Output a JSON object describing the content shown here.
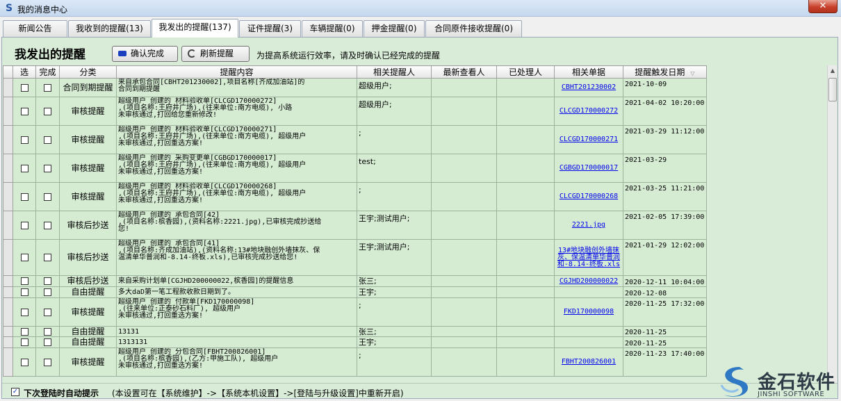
{
  "window": {
    "title": "我的消息中心",
    "close_label": "✕"
  },
  "tabs": [
    {
      "label": "新闻公告"
    },
    {
      "label": "我收到的提醒(13)"
    },
    {
      "label": "我发出的提醒(137)"
    },
    {
      "label": "证件提醒(3)"
    },
    {
      "label": "车辆提醒(0)"
    },
    {
      "label": "押金提醒(0)"
    },
    {
      "label": "合同原件接收提醒(0)"
    }
  ],
  "toolbar": {
    "heading": "我发出的提醒",
    "confirm_label": "确认完成",
    "refresh_label": "刷新提醒",
    "hint": "为提高系统运行效率，请及时确认已经完成的提醒"
  },
  "table": {
    "columns": [
      "选",
      "完成",
      "分类",
      "提醒内容",
      "相关提醒人",
      "最新查看人",
      "已处理人",
      "相关单据",
      "提醒触发日期"
    ],
    "sort_glyph": "▽",
    "rows": [
      {
        "type": "合同到期提醒",
        "content": [
          "来自承包合同[CBHT201230002],项目名称[齐成加油站]的",
          "合同到期提醒"
        ],
        "people": "超级用户;",
        "doc": "CBHT201230002",
        "date": "2021-10-09"
      },
      {
        "type": "审核提醒",
        "content": [
          "超级用户 创建的 材料验收单[CLCGD170000272]",
          ",(项目名称:王府井广场),(往来单位:南方电缆), 小路",
          "未审核通过,打回给您重新修改!"
        ],
        "people": "超级用户;",
        "doc": "CLCGD170000272",
        "date": "2021-04-02 10:20:00"
      },
      {
        "type": "审核提醒",
        "content": [
          "超级用户 创建的 材料验收单[CLCGD170000271]",
          ",(项目名称:王府井广场),(往来单位:南方电缆), 超级用户",
          "未审核通过,打回重选方案!"
        ],
        "people": ";",
        "doc": "CLCGD170000271",
        "date": "2021-03-29 11:12:00"
      },
      {
        "type": "审核提醒",
        "content": [
          "超级用户 创建的 采购变更单[CGBGD170000017]",
          ",(项目名称:王府井广场),(往来单位:南方电缆), 超级用户",
          "未审核通过,打回重选方案!"
        ],
        "people": "test;",
        "doc": "CGBGD170000017",
        "date": "2021-03-29"
      },
      {
        "type": "审核提醒",
        "content": [
          "超级用户 创建的 材料验收单[CLCGD170000268]",
          ",(项目名称:王府井广场),(往来单位:南方电缆), 超级用户",
          "未审核通过,打回重选方案!"
        ],
        "people": ";",
        "doc": "CLCGD170000268",
        "date": "2021-03-25 11:21:00"
      },
      {
        "type": "审核后抄送",
        "content": [
          "超级用户 创建的 承包合同[42]",
          ",(项目名称:槟香园),(资料名称:2221.jpg),已审核完成抄送给",
          "您!"
        ],
        "people": "王宇;测试用户;",
        "doc": "2221.jpg",
        "date": "2021-02-05 17:39:00"
      },
      {
        "type": "审核后抄送",
        "content": [
          "超级用户 创建的 承包合同[41]",
          ",(项目名称:齐成加油站),(资料名称:13#地块融创外墙抹灰、保",
          "温清单华普润和-8.14-终板.xls),已审核完成抄送给您!"
        ],
        "people": "王宇;测试用户;",
        "doc": "13#地块融创外墙抹灰、保温清单华普润和-8.14-终板.xls",
        "date": "2021-01-29 12:02:00"
      },
      {
        "type": "审核后抄送",
        "content": [
          "来自采购计划单[CGJHD200000022,槟香园]的提醒信息"
        ],
        "people": "张三;",
        "doc": "CGJHD200000022",
        "date": "2020-12-11 10:04:00"
      },
      {
        "type": "自由提醒",
        "content": [
          "多大daD第一笔工程款收款日期到了。"
        ],
        "people": "王宇;",
        "doc": "",
        "date": "2020-12-08"
      },
      {
        "type": "审核提醒",
        "content": [
          "超级用户 创建的 付款单[FKD170000098]",
          ",(往来单位:正泰砂石料厂), 超级用户",
          "未审核通过,打回重选方案!"
        ],
        "people": ";",
        "doc": "FKD170000098",
        "date": "2020-11-25 17:32:00"
      },
      {
        "type": "自由提醒",
        "content": [
          "13131"
        ],
        "people": "张三;",
        "doc": "",
        "date": "2020-11-25"
      },
      {
        "type": "自由提醒",
        "content": [
          "1313131"
        ],
        "people": "王宇;",
        "doc": "",
        "date": "2020-11-25"
      },
      {
        "type": "审核提醒",
        "content": [
          "超级用户 创建的 分包合同[FBHT200826001]",
          ",(项目名称:槟香园),(乙方:甲施工队), 超级用户",
          "未审核通过,打回重选方案!"
        ],
        "people": ";",
        "doc": "FBHT200826001",
        "date": "2020-11-23 17:40:00"
      }
    ]
  },
  "footer": {
    "auto_prompt_label": "下次登陆时自动提示",
    "note": "(本设置可在【系统维护】->【系统本机设置】->[登陆与升级设置]中重新开启)"
  },
  "watermark": {
    "name_cn": "金石软件",
    "name_en": "JINSHI SOFTWARE"
  }
}
